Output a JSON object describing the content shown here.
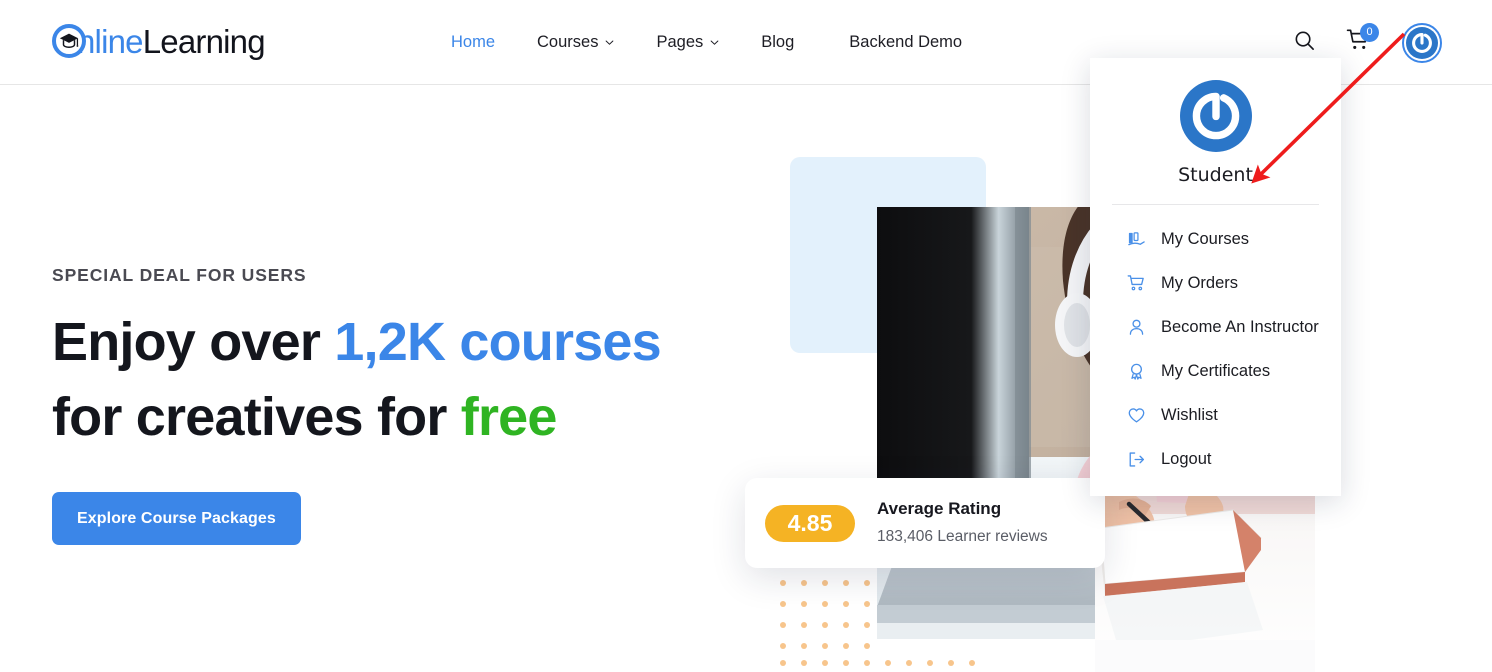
{
  "brand": {
    "logo_text_primary": "nline",
    "logo_text_secondary": "Learning",
    "logo_icon": "graduation-cap-icon",
    "accent_blue": "#3b86e8",
    "accent_green": "#2fb422",
    "accent_orange": "#f5b324"
  },
  "header": {
    "nav": [
      {
        "label": "Home",
        "active": true,
        "has_caret": false
      },
      {
        "label": "Courses",
        "active": false,
        "has_caret": true
      },
      {
        "label": "Pages",
        "active": false,
        "has_caret": true
      },
      {
        "label": "Blog",
        "active": false,
        "has_caret": false
      },
      {
        "label": "Backend Demo",
        "active": false,
        "has_caret": false
      }
    ],
    "search_icon": "search-icon",
    "cart_icon": "shopping-cart-icon",
    "cart_count": "0",
    "avatar_icon": "power-avatar-icon"
  },
  "hero": {
    "eyebrow": "SPECIAL DEAL FOR USERS",
    "headline_part1": "Enjoy over ",
    "headline_highlight_blue": "1,2K courses",
    "headline_part2": "for creatives for ",
    "headline_highlight_green": "free",
    "cta_label": "Explore Course Packages",
    "rating": {
      "score": "4.85",
      "title": "Average Rating",
      "subtitle": "183,406 Learner reviews"
    }
  },
  "user_dropdown": {
    "avatar_icon": "power-avatar-icon",
    "username": "Student",
    "items": [
      {
        "label": "My Courses",
        "icon": "courses-icon"
      },
      {
        "label": "My Orders",
        "icon": "shopping-cart-icon"
      },
      {
        "label": "Become An Instructor",
        "icon": "user-icon"
      },
      {
        "label": "My Certificates",
        "icon": "certificate-badge-icon"
      },
      {
        "label": "Wishlist",
        "icon": "heart-icon"
      },
      {
        "label": "Logout",
        "icon": "logout-icon"
      }
    ]
  },
  "annotation": {
    "arrow_color": "#ee1c1c",
    "points_to": "Student"
  }
}
